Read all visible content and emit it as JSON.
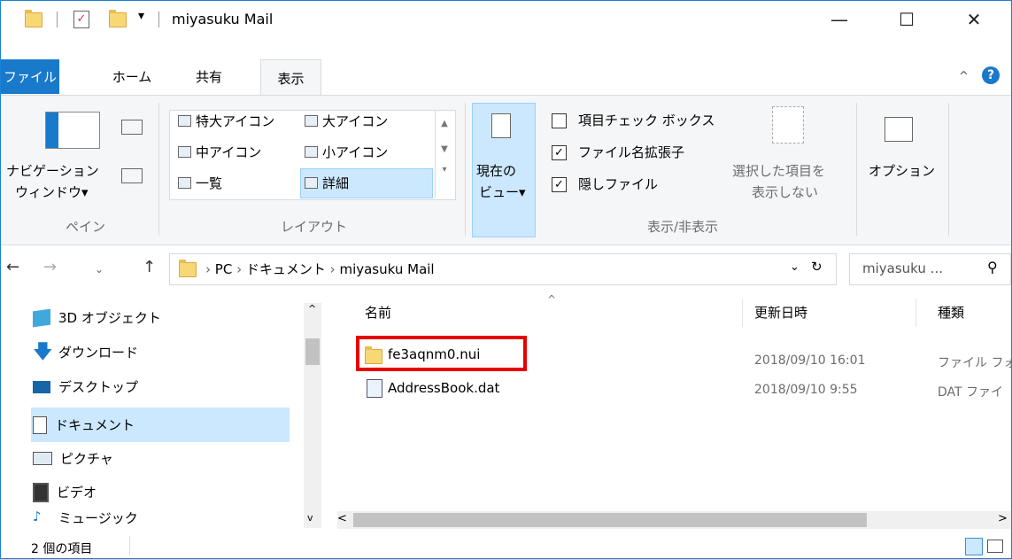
{
  "window": {
    "title": "miyasuku Mail"
  },
  "caption": {
    "minimize": "—",
    "maximize": "☐",
    "close": "✕"
  },
  "ribbon_tabs": [
    "ファイル",
    "ホーム",
    "共有",
    "表示"
  ],
  "ribbon": {
    "pane": {
      "nav_pane_line1": "ナビゲーション",
      "nav_pane_line2": "ウィンドウ▾",
      "group_label": "ペイン"
    },
    "layout": {
      "items": [
        "特大アイコン",
        "大アイコン",
        "中アイコン",
        "小アイコン",
        "一覧",
        "詳細"
      ],
      "group_label": "レイアウト"
    },
    "current_view": {
      "line1": "現在の",
      "line2": "ビュー▾"
    },
    "show_hide": {
      "item_checkbox": "項目チェック ボックス",
      "file_ext": "ファイル名拡張子",
      "hidden_files": "隠しファイル",
      "hide_selected_line1": "選択した項目を",
      "hide_selected_line2": "表示しない",
      "group_label": "表示/非表示"
    },
    "options": "オプション"
  },
  "address": {
    "path": [
      "PC",
      "ドキュメント",
      "miyasuku Mail"
    ],
    "search_placeholder": "miyasuku ..."
  },
  "nav_pane": [
    "3D オブジェクト",
    "ダウンロード",
    "デスクトップ",
    "ドキュメント",
    "ピクチャ",
    "ビデオ",
    "ミュージック"
  ],
  "columns": {
    "name": "名前",
    "modified": "更新日時",
    "type": "種類"
  },
  "files": [
    {
      "name": "fe3aqnm0.nui",
      "modified": "2018/09/10 16:01",
      "type": "ファイル フォ"
    },
    {
      "name": "AddressBook.dat",
      "modified": "2018/09/10 9:55",
      "type": "DAT ファイ"
    }
  ],
  "status": {
    "item_count": "2 個の項目"
  },
  "colors": {
    "accent": "#1979ca",
    "highlight_box": "#e80000",
    "selection": "#cce8ff"
  }
}
